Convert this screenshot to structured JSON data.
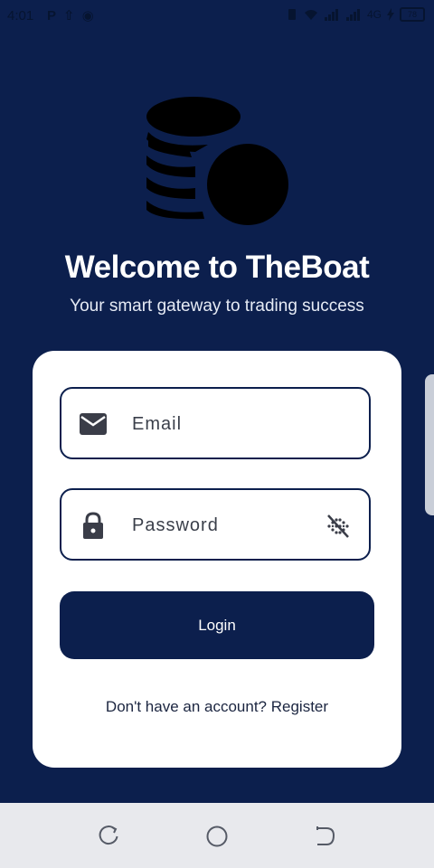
{
  "status_bar": {
    "time": "4:01",
    "app_icons": [
      "P",
      "⇧",
      "◉"
    ],
    "network_text": "4G",
    "battery_level": "78"
  },
  "header": {
    "title": "Welcome to TheBoat",
    "subtitle": "Your smart gateway to trading success"
  },
  "login_form": {
    "email_placeholder": "Email",
    "password_placeholder": "Password",
    "login_label": "Login",
    "register_prompt": "Don't have an account?",
    "register_label": "Register"
  },
  "colors": {
    "background": "#0c1f4d",
    "card": "#ffffff",
    "button": "#0c1f4d",
    "nav_bar": "#e8e9ed"
  },
  "icons": {
    "logo": "coin-stack-icon",
    "email": "envelope-icon",
    "password": "lock-icon",
    "visibility": "visibility-off-icon",
    "nav": [
      "recent-apps-icon",
      "home-icon",
      "back-icon"
    ]
  }
}
